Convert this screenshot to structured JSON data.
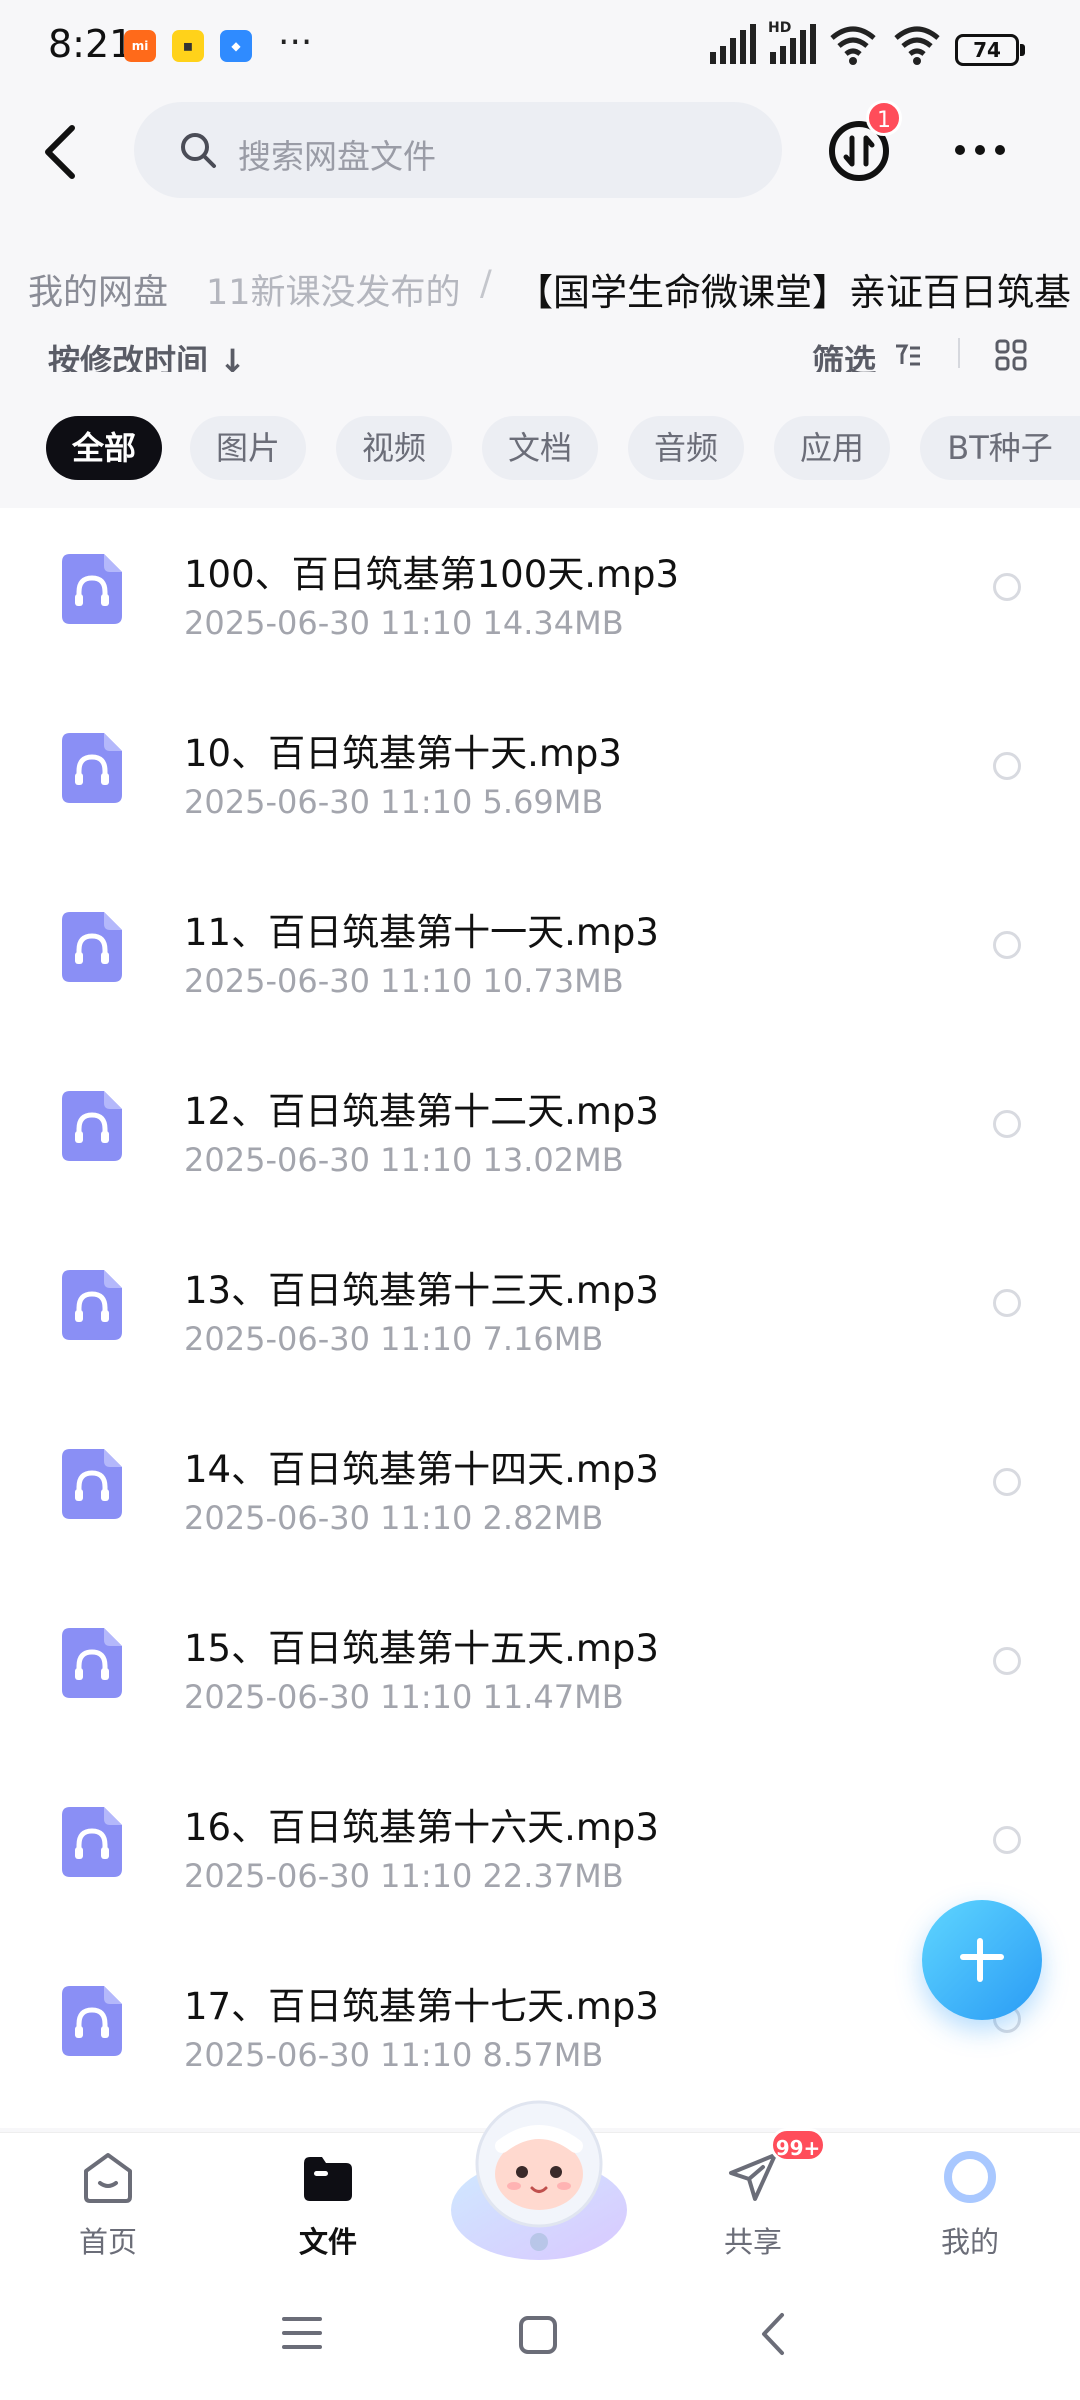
{
  "status_bar": {
    "time": "8:21",
    "more": "···",
    "network": "HD",
    "battery": "74"
  },
  "header": {
    "search_placeholder": "搜索网盘文件",
    "transfer_badge": "1"
  },
  "breadcrumb": {
    "root": "我的网盘",
    "middle": "11新课没发布的",
    "separator": "/",
    "current": "【国学生命微课堂】亲证百日筑基"
  },
  "sort_bar": {
    "sort_label": "按修改时间 ↓",
    "filter_label": "筛选"
  },
  "tabs": [
    "全部",
    "图片",
    "视频",
    "文档",
    "音频",
    "应用",
    "BT种子"
  ],
  "files": [
    {
      "name": "100、百日筑基第100天.mp3",
      "meta": "2025-06-30  11:10  14.34MB"
    },
    {
      "name": "10、百日筑基第十天.mp3",
      "meta": "2025-06-30  11:10  5.69MB"
    },
    {
      "name": "11、百日筑基第十一天.mp3",
      "meta": "2025-06-30  11:10  10.73MB"
    },
    {
      "name": "12、百日筑基第十二天.mp3",
      "meta": "2025-06-30  11:10  13.02MB"
    },
    {
      "name": "13、百日筑基第十三天.mp3",
      "meta": "2025-06-30  11:10  7.16MB"
    },
    {
      "name": "14、百日筑基第十四天.mp3",
      "meta": "2025-06-30  11:10  2.82MB"
    },
    {
      "name": "15、百日筑基第十五天.mp3",
      "meta": "2025-06-30  11:10  11.47MB"
    },
    {
      "name": "16、百日筑基第十六天.mp3",
      "meta": "2025-06-30  11:10  22.37MB"
    },
    {
      "name": "17、百日筑基第十七天.mp3",
      "meta": "2025-06-30  11:10  8.57MB"
    }
  ],
  "bottom_nav": {
    "home": "首页",
    "files": "文件",
    "share": "共享",
    "share_badge": "99+",
    "me": "我的"
  },
  "colors": {
    "accent_blue": "#2a9bf5",
    "audio_icon": "#8a8ff5",
    "badge_red": "#ff4d5a",
    "active_tab": "#0e0e14"
  }
}
